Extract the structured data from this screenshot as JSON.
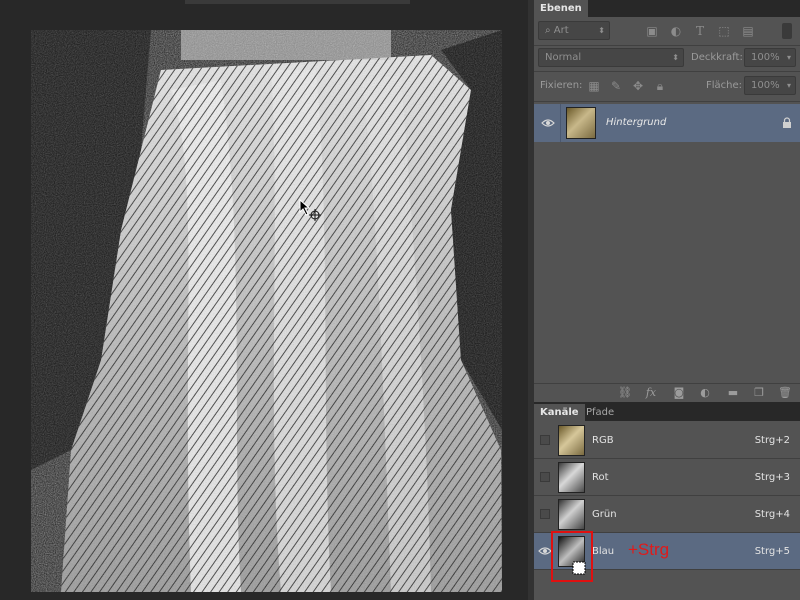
{
  "colors": {
    "panel_bg": "#535353",
    "selected_row": "#5b6a82",
    "annotation_red": "#e01010"
  },
  "layers_panel": {
    "tab_label": "Ebenen",
    "filter_label": "Art",
    "blend_mode": "Normal",
    "opacity_label": "Deckkraft:",
    "opacity_value": "100%",
    "lock_label": "Fixieren:",
    "fill_label": "Fläche:",
    "fill_value": "100%",
    "layers": [
      {
        "name": "Hintergrund",
        "visible": true,
        "locked": true
      }
    ],
    "filter_icons": [
      "image-filter-icon",
      "adjustment-filter-icon",
      "type-filter-icon",
      "shape-filter-icon",
      "smart-object-filter-icon"
    ],
    "lock_icons": [
      "lock-transparent-icon",
      "lock-brush-icon",
      "lock-position-icon",
      "lock-all-icon"
    ],
    "footer_icons": [
      "link-layers-icon",
      "fx-icon",
      "add-mask-icon",
      "adjustment-layer-icon",
      "new-group-icon",
      "new-layer-icon",
      "trash-icon"
    ],
    "fx_label": "fx"
  },
  "channels_panel": {
    "tabs": [
      "Kanäle",
      "Pfade"
    ],
    "channels": [
      {
        "name": "RGB",
        "shortcut": "Strg+2",
        "visible": false,
        "selected": false
      },
      {
        "name": "Rot",
        "shortcut": "Strg+3",
        "visible": false,
        "selected": false
      },
      {
        "name": "Grün",
        "shortcut": "Strg+4",
        "visible": false,
        "selected": false
      },
      {
        "name": "Blau",
        "shortcut": "Strg+5",
        "visible": true,
        "selected": true
      }
    ]
  },
  "annotation": {
    "text": "+Strg"
  },
  "canvas": {
    "image": "waterfall-blue-channel-with-selection"
  }
}
